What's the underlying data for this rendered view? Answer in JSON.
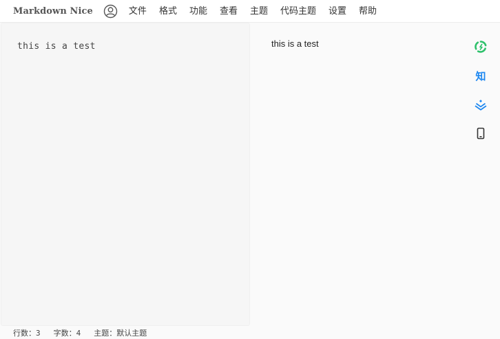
{
  "app": {
    "brand": "Markdown Nice",
    "menu": [
      {
        "label": "文件"
      },
      {
        "label": "格式"
      },
      {
        "label": "功能"
      },
      {
        "label": "查看"
      },
      {
        "label": "主题"
      },
      {
        "label": "代码主题"
      },
      {
        "label": "设置"
      },
      {
        "label": "帮助"
      }
    ]
  },
  "editor": {
    "content": "this is a test"
  },
  "preview": {
    "content": "this is a test"
  },
  "toolbar": {
    "zhihu_label": "知",
    "tools": [
      {
        "icon": "wechat-copy-icon",
        "color": "#2ec16b"
      },
      {
        "icon": "zhihu-icon",
        "color": "#1d87f0"
      },
      {
        "icon": "juejin-icon",
        "color": "#1d87f0"
      },
      {
        "icon": "mobile-preview-icon",
        "color": "#333333"
      }
    ]
  },
  "status": {
    "lines": "行数：3",
    "words": "字数：4",
    "theme": "主题：默认主题"
  }
}
